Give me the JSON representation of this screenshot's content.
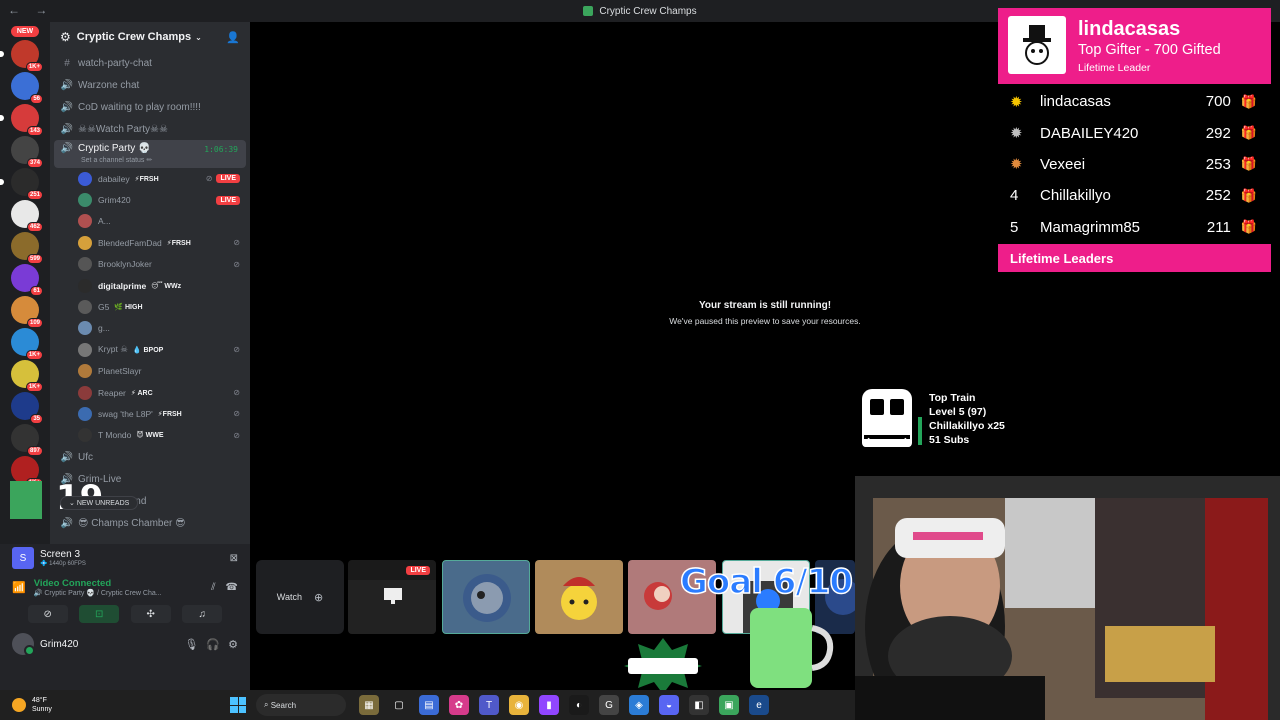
{
  "window": {
    "title": "Cryptic Crew Champs",
    "nav": "← →"
  },
  "rail": {
    "new_label": "NEW",
    "servers": [
      {
        "badge": "1K+",
        "color": "#c0392b"
      },
      {
        "badge": "56",
        "color": "#3b6fd6"
      },
      {
        "badge": "143",
        "color": "#d63b3b"
      },
      {
        "badge": "374",
        "color": "#444"
      },
      {
        "badge": "251",
        "color": "#2b2b2b"
      },
      {
        "badge": "462",
        "color": "#e8e8e8"
      },
      {
        "badge": "599",
        "color": "#8b6b2b"
      },
      {
        "badge": "61",
        "color": "#7a3bd6"
      },
      {
        "badge": "109",
        "color": "#d68b3b"
      },
      {
        "badge": "1K+",
        "color": "#2b8bd6"
      },
      {
        "badge": "1K+",
        "color": "#d6c03b"
      },
      {
        "badge": "35",
        "color": "#1e3b8b"
      },
      {
        "badge": "897",
        "color": "#333"
      },
      {
        "badge": "1K+",
        "color": "#b02020"
      }
    ]
  },
  "sidebar": {
    "guild_name": "Cryptic Crew Champs",
    "channels_top": [
      {
        "icon": "#",
        "name": "watch-party-chat"
      },
      {
        "icon": "🔊",
        "name": "Warzone chat"
      },
      {
        "icon": "🔊",
        "name": "CoD waiting to play room!!!!"
      },
      {
        "icon": "🔊",
        "name": "☠☠Watch Party☠☠"
      }
    ],
    "active_channel": {
      "name": "Cryptic Party 💀",
      "status": "Set a channel status ✏",
      "timer": "1:06:39"
    },
    "voice_users": [
      {
        "name": "dabailey",
        "tag": "⚡FRSH",
        "live": true,
        "muted": true,
        "bold": false,
        "color": "#3b5bd6"
      },
      {
        "name": "Grim420",
        "tag": "",
        "live": true,
        "muted": false,
        "bold": false,
        "color": "#3b8b6b"
      },
      {
        "name": "A...",
        "tag": "",
        "live": false,
        "muted": false,
        "bold": false,
        "color": "#b05050"
      },
      {
        "name": "BlendedFamDad",
        "tag": "⚡FRSH",
        "live": false,
        "muted": true,
        "bold": false,
        "color": "#d6a03b"
      },
      {
        "name": "BrooklynJoker",
        "tag": "",
        "live": false,
        "muted": true,
        "bold": false,
        "color": "#555"
      },
      {
        "name": "digitalprime",
        "tag": "😴 WWz",
        "live": false,
        "muted": false,
        "bold": true,
        "color": "#2b2b2b"
      },
      {
        "name": "G5",
        "tag": "🌿 HIGH",
        "live": false,
        "muted": false,
        "bold": false,
        "cam": true,
        "color": "#5a5a5a"
      },
      {
        "name": "g...",
        "tag": "",
        "live": false,
        "muted": false,
        "bold": false,
        "color": "#6b8bb0"
      },
      {
        "name": "Krypt ☠",
        "tag": "💧 BPOP",
        "live": false,
        "muted": true,
        "bold": false,
        "color": "#777"
      },
      {
        "name": "PlanetSlayr",
        "tag": "",
        "live": false,
        "muted": false,
        "bold": false,
        "color": "#b07a3b"
      },
      {
        "name": "Reaper",
        "tag": "⚡ ARC",
        "live": false,
        "muted": true,
        "bold": false,
        "color": "#8b3b3b"
      },
      {
        "name": "swag 'the L8P'",
        "tag": "⚡FRSH",
        "live": false,
        "muted": true,
        "bold": false,
        "color": "#3b6bb0"
      },
      {
        "name": "T Mondo",
        "tag": "😈 WWE",
        "live": false,
        "muted": true,
        "bold": false,
        "color": "#333"
      }
    ],
    "channels_bottom": [
      {
        "icon": "🔊",
        "name": "Ufc"
      },
      {
        "icon": "🔊",
        "name": "Grim-Live"
      },
      {
        "icon": "🔊",
        "name": "...-underground"
      },
      {
        "icon": "🔊",
        "name": "😎 Champs Chamber 😎"
      }
    ],
    "new_unreads": "NEW UNREADS",
    "big_number": "19"
  },
  "voice_panel": {
    "screen_title": "Screen 3",
    "screen_sub": "💠 1440p 60FPS",
    "vc_title": "Video Connected",
    "vc_sub": "🔊 Cryptic Party 💀 / Cryptic Crew Cha...",
    "username": "Grim420"
  },
  "stage": {
    "paused_title": "Your stream is still running!",
    "paused_body": "We've paused this preview to save your resources.",
    "watch_label": "Watch",
    "live_label": "LIVE",
    "goal_text": "Goal 6/10"
  },
  "leaderboard": {
    "top_name": "lindacasas",
    "top_line": "Top Gifter - 700 Gifted",
    "top_sub": "Lifetime Leader",
    "rows": [
      {
        "rank": "✹",
        "name": "lindacasas",
        "value": "700"
      },
      {
        "rank": "✹",
        "name": "DABAILEY420",
        "value": "292"
      },
      {
        "rank": "✹",
        "name": "Vexeei",
        "value": "253"
      },
      {
        "rank": "4",
        "name": "Chillakillyo",
        "value": "252"
      },
      {
        "rank": "5",
        "name": "Mamagrimm85",
        "value": "211"
      }
    ],
    "footer": "Lifetime Leaders",
    "accent": "#ee1e8a"
  },
  "train": {
    "title": "Top Train",
    "level": "Level 5 (97)",
    "user": "Chillakillyo x25",
    "subs": "51 Subs"
  },
  "taskbar": {
    "temp": "48°F",
    "weather": "Sunny",
    "search": "Search"
  }
}
